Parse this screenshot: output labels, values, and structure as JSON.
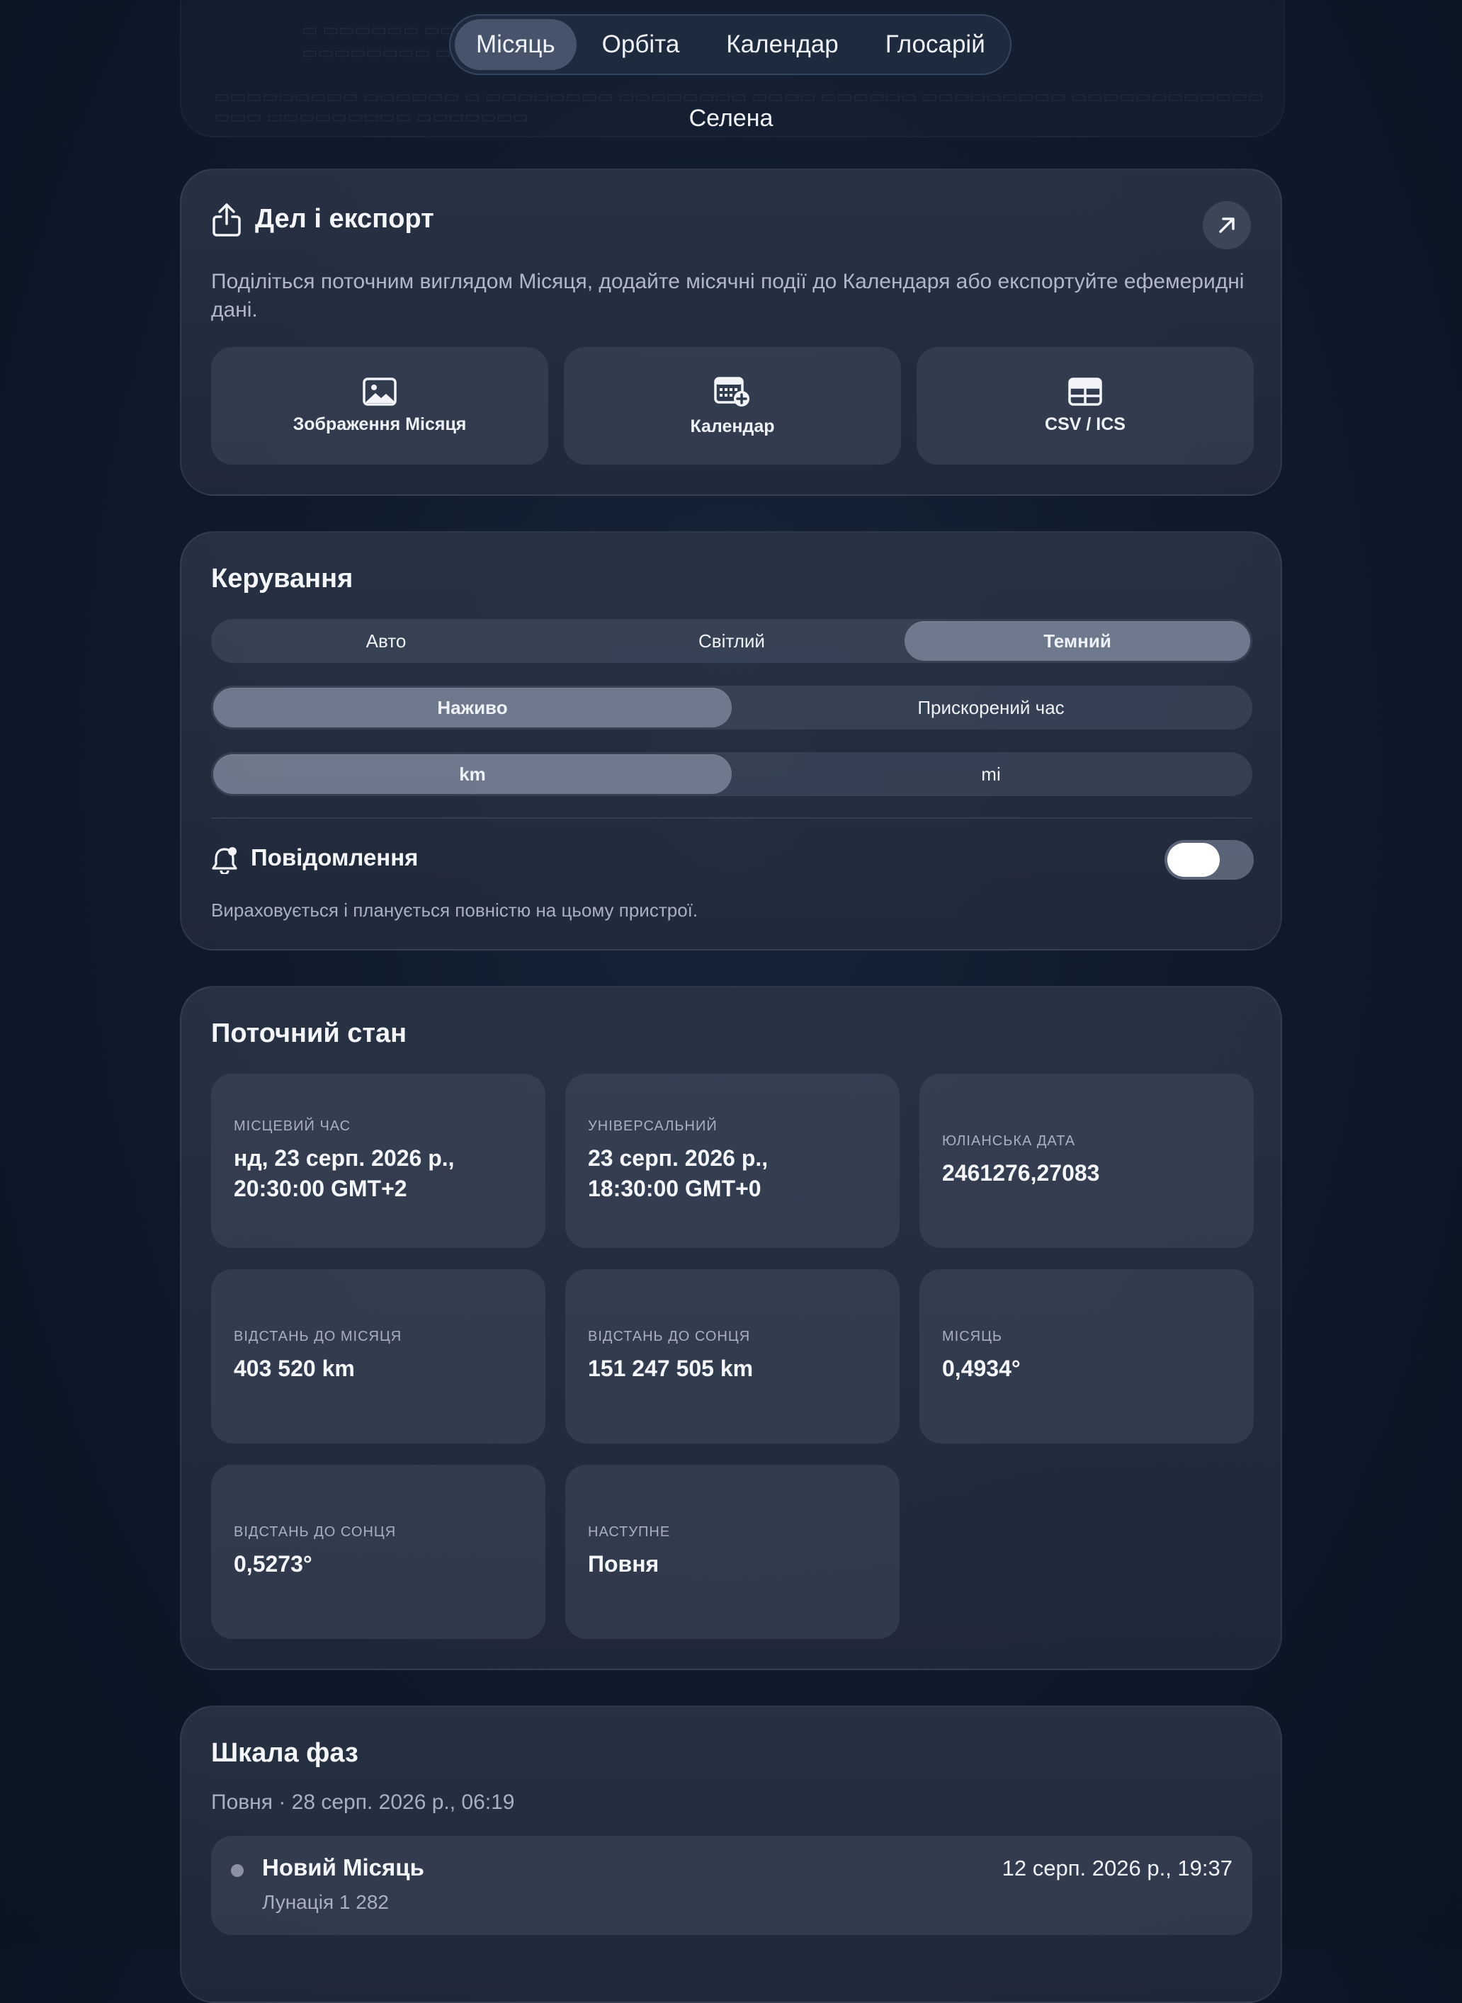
{
  "nav": {
    "tabs": [
      {
        "label": "Місяць",
        "active": true
      },
      {
        "label": "Орбіта",
        "active": false
      },
      {
        "label": "Календар",
        "active": false
      },
      {
        "label": "Глосарій",
        "active": false
      }
    ],
    "subtitle": "Селена"
  },
  "share": {
    "title": "Дел і експорт",
    "description": "Поділіться поточним виглядом Місяця, додайте місячні події до Календаря або експортуйте ефемеридні дані.",
    "buttons": [
      {
        "label": "Зображення Місяця",
        "icon": "image-icon"
      },
      {
        "label": "Календар",
        "icon": "calendar-add-icon"
      },
      {
        "label": "CSV / ICS",
        "icon": "table-icon"
      }
    ]
  },
  "controls": {
    "title": "Керування",
    "theme": {
      "options": [
        "Авто",
        "Світлий",
        "Темний"
      ],
      "selected": "Темний"
    },
    "time_mode": {
      "options": [
        "Наживо",
        "Прискорений час"
      ],
      "selected": "Наживо"
    },
    "units": {
      "options": [
        "km",
        "mi"
      ],
      "selected": "km"
    },
    "notifications": {
      "label": "Повідомлення",
      "enabled": false,
      "note": "Вираховується і планується повністю на цьому пристрої."
    }
  },
  "state": {
    "title": "Поточний стан",
    "tiles": [
      {
        "label": "місцевий час",
        "value_lines": [
          "нд, 23 серп. 2026 р.,",
          "20:30:00 GMT+2"
        ]
      },
      {
        "label": "універсальний",
        "value_lines": [
          "23 серп. 2026 р.,",
          "18:30:00 GMT+0"
        ]
      },
      {
        "label": "юліанська дата",
        "value_lines": [
          "2461276,27083"
        ]
      },
      {
        "label": "відстань до місяця",
        "value_lines": [
          "403 520 km"
        ]
      },
      {
        "label": "відстань до сонця",
        "value_lines": [
          "151 247 505 km"
        ]
      },
      {
        "label": "місяць",
        "value_lines": [
          "0,4934°"
        ]
      },
      {
        "label": "відстань до сонця",
        "value_lines": [
          "0,5273°"
        ]
      },
      {
        "label": "наступне",
        "value_lines": [
          "Повня"
        ]
      }
    ]
  },
  "phases": {
    "title": "Шкала фаз",
    "subtitle": "Повня · 28 серп. 2026 р., 06:19",
    "rows": [
      {
        "name": "Новий Місяць",
        "detail": "Лунація 1 282",
        "date": "12 серп. 2026 р., 19:37"
      }
    ]
  },
  "colors": {
    "accent_active": "#7f8aa3",
    "toggle_knob": "#ffffff",
    "background": "#0f1b2c"
  }
}
